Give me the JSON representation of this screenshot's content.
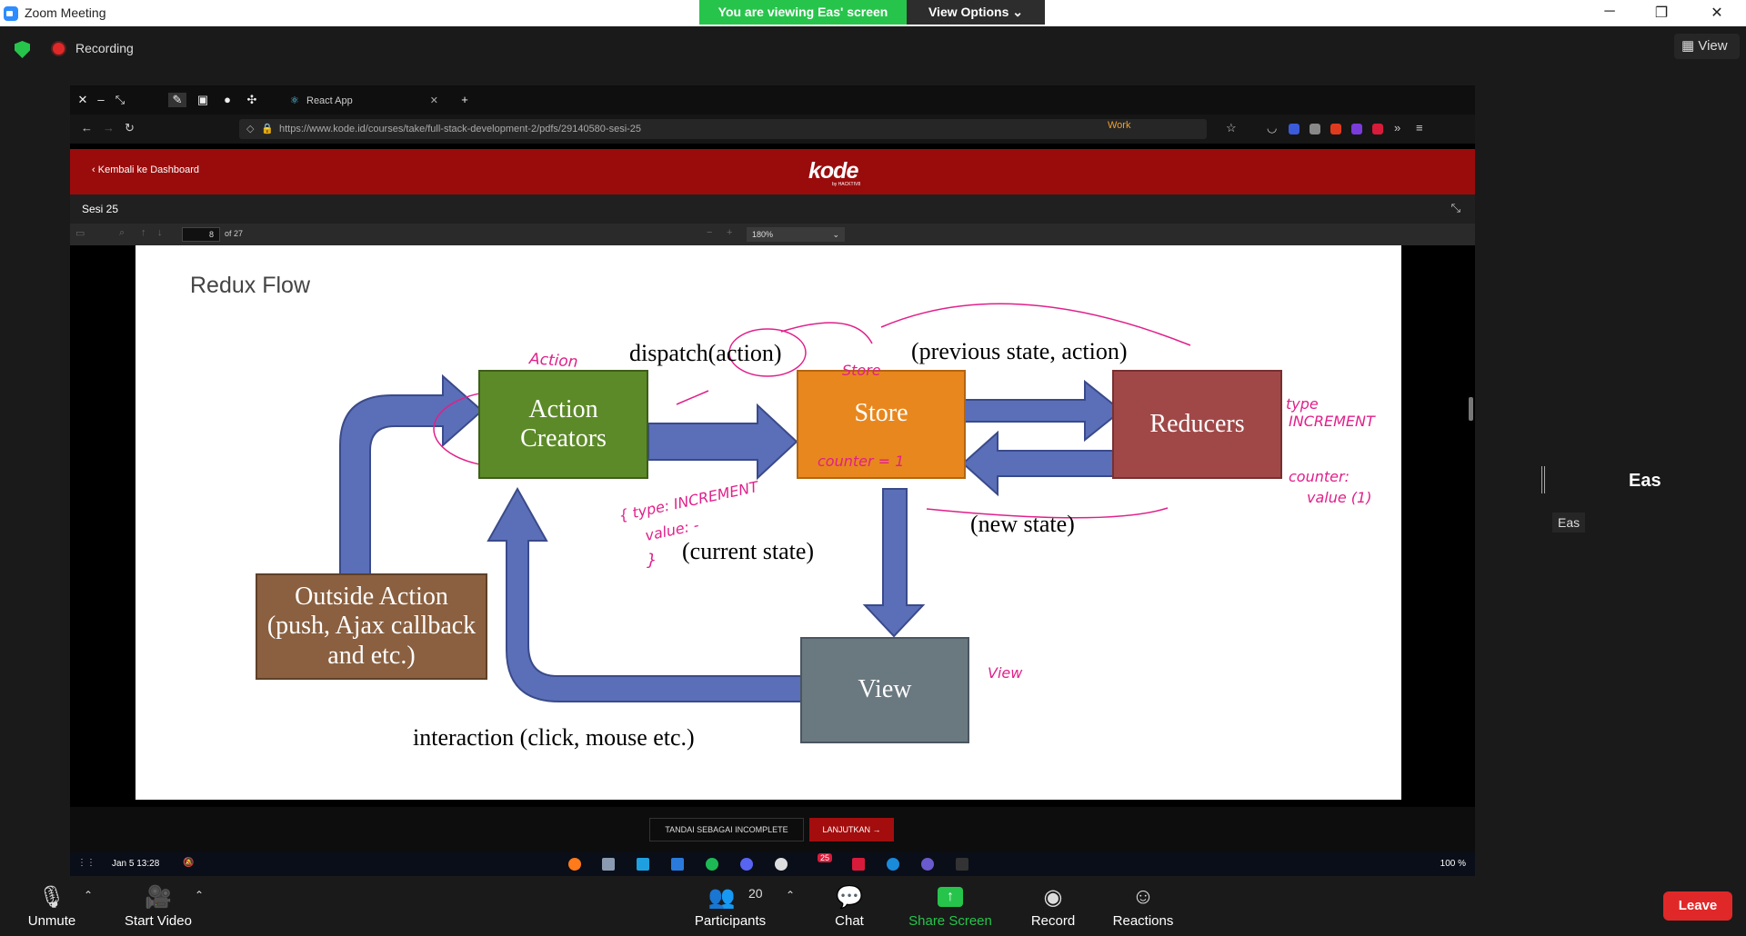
{
  "window": {
    "title": "Zoom Meeting",
    "viewing_banner": "You are viewing Eas' screen",
    "view_options": "View Options ⌄"
  },
  "topbar": {
    "recording_label": "Recording",
    "view_label": "View"
  },
  "browser": {
    "tab_title": "React App",
    "url": "https://www.kode.id/courses/take/full-stack-development-2/pdfs/29140580-sesi-25",
    "work_label": "Work",
    "site_back": "Kembali ke Dashboard",
    "logo_text": "kode",
    "logo_sub": "by HACKTIV8"
  },
  "pdf": {
    "session_title": "Sesi 25",
    "page_current": "8",
    "page_of": "of 27",
    "zoom": "180%"
  },
  "slide": {
    "title": "Redux Flow",
    "boxes": {
      "action_creators": "Action Creators",
      "store": "Store",
      "reducers": "Reducers",
      "outside_action": "Outside Action (push, Ajax callback and etc.)",
      "view": "View"
    },
    "labels": {
      "dispatch": "dispatch(action)",
      "prev_state": "(previous state, action)",
      "new_state": "(new state)",
      "current_state": "(current state)",
      "interaction": "interaction (click, mouse etc.)"
    },
    "annotations": {
      "action": "Action",
      "store": "Store",
      "counter": "counter = 1",
      "type_increment_left": "{ type: INCREMENT",
      "value_left": "value: -",
      "brace_close": "}",
      "type_right": "type",
      "increment_right": "INCREMENT",
      "counter_right": "counter:",
      "value_right": "value (1)",
      "view": "View"
    }
  },
  "course_footer": {
    "mark_incomplete": "TANDAI SEBAGAI INCOMPLETE",
    "next": "LANJUTKAN →"
  },
  "os_taskbar": {
    "date": "Jan 5  13:28",
    "battery": "100 %",
    "badge": "25"
  },
  "participant": {
    "name": "Eas"
  },
  "controls": {
    "unmute": "Unmute",
    "start_video": "Start Video",
    "participants": "Participants",
    "participants_count": "20",
    "chat": "Chat",
    "share_screen": "Share Screen",
    "record": "Record",
    "reactions": "Reactions",
    "leave": "Leave"
  },
  "colors": {
    "zoom_green": "#27c44b",
    "kode_red": "#9a0c0c",
    "action_creators": "#5c8a28",
    "store": "#e8871e",
    "reducers": "#a04848",
    "outside_action": "#8a6040",
    "view": "#6a7880",
    "arrows": "#5a6fb8",
    "annotation": "#e0208a"
  }
}
